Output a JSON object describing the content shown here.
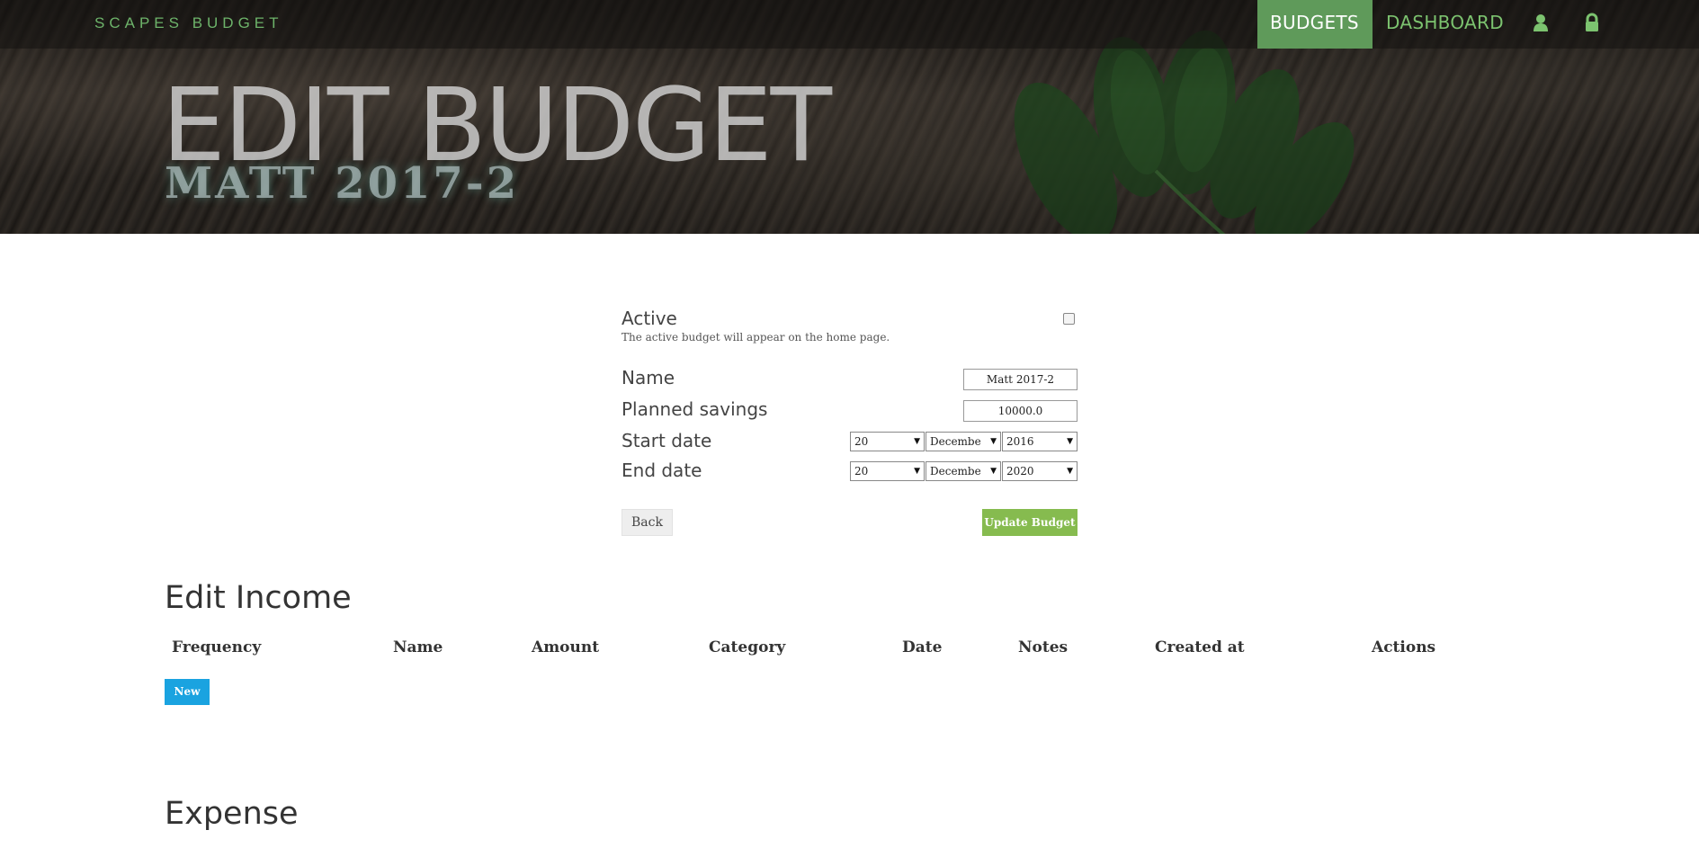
{
  "nav": {
    "brand": "SCAPES BUDGET",
    "links": [
      {
        "label": "BUDGETS",
        "active": true
      },
      {
        "label": "DASHBOARD",
        "active": false
      }
    ],
    "icons": [
      "user-icon",
      "lock-icon"
    ],
    "accent_color": "#7cc36f",
    "active_bg": "#5f9a5a"
  },
  "hero": {
    "title": "EDIT BUDGET",
    "subtitle": "MATT 2017-2"
  },
  "form": {
    "active": {
      "label": "Active",
      "help": "The active budget will appear on the home page.",
      "checked": false
    },
    "name": {
      "label": "Name",
      "value": "Matt 2017-2"
    },
    "planned_savings": {
      "label": "Planned savings",
      "value": "10000.0"
    },
    "start_date": {
      "label": "Start date",
      "day": "20",
      "month": "Decembe",
      "year": "2016"
    },
    "end_date": {
      "label": "End date",
      "day": "20",
      "month": "Decembe",
      "year": "2020"
    },
    "back_label": "Back",
    "update_label": "Update Budget",
    "update_color": "#86bb4f"
  },
  "income": {
    "title": "Edit Income",
    "columns": [
      "Frequency",
      "Name",
      "Amount",
      "Category",
      "Date",
      "Notes",
      "Created at",
      "Actions"
    ],
    "new_label": "New",
    "new_color": "#1aa3e0"
  },
  "expense": {
    "title": "Expense"
  }
}
